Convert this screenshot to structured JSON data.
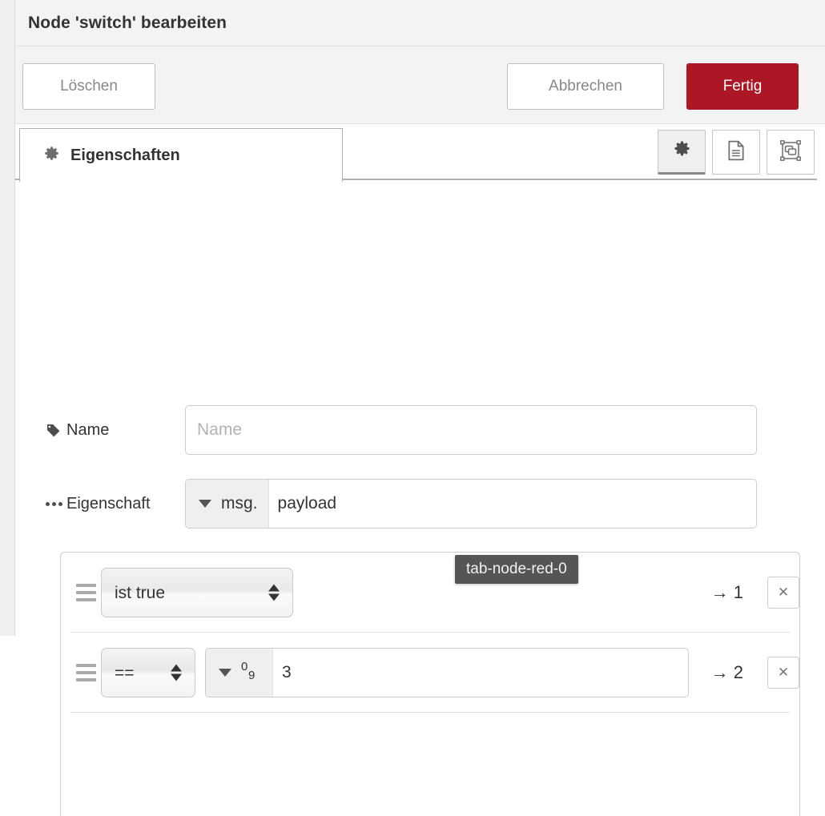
{
  "dialog": {
    "title": "Node 'switch' bearbeiten"
  },
  "toolbar": {
    "delete_label": "Löschen",
    "cancel_label": "Abbrechen",
    "done_label": "Fertig",
    "done_color": "#ad1625"
  },
  "tabs": {
    "active_tab": {
      "label": "Eigenschaften",
      "icon": "gear-icon"
    },
    "icon_buttons": [
      {
        "name": "settings",
        "icon": "gear-icon",
        "active": true
      },
      {
        "name": "description",
        "icon": "document-icon",
        "active": false
      },
      {
        "name": "appearance",
        "icon": "appearance-icon",
        "active": false
      }
    ]
  },
  "form": {
    "name_row": {
      "label": "Name",
      "icon": "tag-icon",
      "input_value": "",
      "input_placeholder": "Name"
    },
    "property_row": {
      "label": "Eigenschaft",
      "icon": "dots-icon",
      "type_label": "msg.",
      "value": "payload"
    }
  },
  "rules": [
    {
      "operator": "ist true",
      "has_value": false,
      "output_label": "→ 1",
      "delete_label": "✕"
    },
    {
      "operator": "==",
      "has_value": true,
      "value_type_icon": "number-type-icon",
      "value_type_digits": {
        "top": "0",
        "bottom": "9"
      },
      "value": "3",
      "output_label": "→ 2",
      "delete_label": "✕"
    }
  ],
  "tooltip": {
    "text": "tab-node-red-0"
  }
}
